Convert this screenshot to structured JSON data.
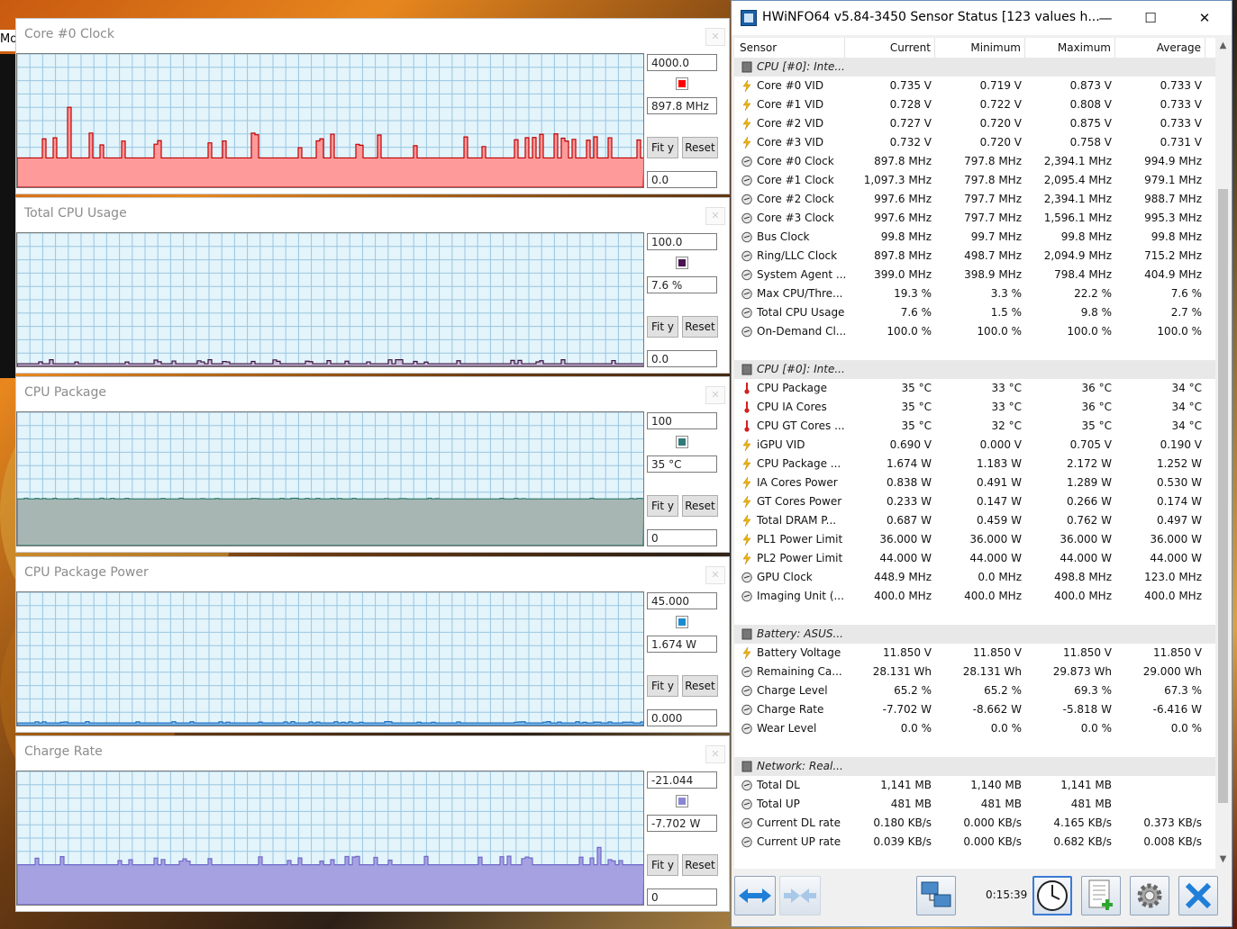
{
  "colors": {
    "accent_hwinfo": "#0066cc",
    "graph_bg": "#e3f4fb",
    "grid": "#9ac6e0"
  },
  "taskbar_fragment": "Mo",
  "graphs": [
    {
      "title": "Core #0 Clock",
      "max": "4000.0",
      "current": "897.8 MHz",
      "min": "0.0",
      "color": "#ff0000",
      "fill": "#ff9a9a",
      "stroke": "#c00000",
      "level": 0.22,
      "spike": 0.6,
      "fity": "Fit y",
      "reset": "Reset"
    },
    {
      "title": "Total CPU Usage",
      "max": "100.0",
      "current": "7.6 %",
      "min": "0.0",
      "color": "#4a1450",
      "fill": "#c8bfd8",
      "stroke": "#3a1040",
      "level": 0.02,
      "spike": 0.08,
      "fity": "Fit y",
      "reset": "Reset"
    },
    {
      "title": "CPU Package",
      "max": "100",
      "current": "35 °C",
      "min": "0",
      "color": "#2f7a78",
      "fill": "#a7b6b2",
      "stroke": "#2a7a70",
      "level": 0.35,
      "spike": 0.36,
      "fity": "Fit y",
      "reset": "Reset"
    },
    {
      "title": "CPU Package Power",
      "max": "45.000",
      "current": "1.674 W",
      "min": "0.000",
      "color": "#1b8bd0",
      "fill": "#7fb8e8",
      "stroke": "#1b6fc0",
      "level": 0.02,
      "spike": 0.04,
      "fity": "Fit y",
      "reset": "Reset"
    },
    {
      "title": "Charge Rate",
      "max": "-21.044",
      "current": "-7.702 W",
      "min": "0",
      "color": "#8a86d6",
      "fill": "#a6a2e2",
      "stroke": "#6e68c8",
      "level": 0.3,
      "spike": 0.43,
      "fity": "Fit y",
      "reset": "Reset"
    }
  ],
  "hwinfo": {
    "title": "HWiNFO64 v5.84-3450 Sensor Status [123 values h...",
    "headers": [
      "Sensor",
      "Current",
      "Minimum",
      "Maximum",
      "Average"
    ],
    "rows": [
      {
        "type": "group",
        "name": "CPU [#0]: Inte..."
      },
      {
        "icon": "bolt-icon",
        "name": "Core #0 VID",
        "v": [
          "0.735 V",
          "0.719 V",
          "0.873 V",
          "0.733 V"
        ]
      },
      {
        "icon": "bolt-icon",
        "name": "Core #1 VID",
        "v": [
          "0.728 V",
          "0.722 V",
          "0.808 V",
          "0.733 V"
        ]
      },
      {
        "icon": "bolt-icon",
        "name": "Core #2 VID",
        "v": [
          "0.727 V",
          "0.720 V",
          "0.875 V",
          "0.733 V"
        ]
      },
      {
        "icon": "bolt-icon",
        "name": "Core #3 VID",
        "v": [
          "0.732 V",
          "0.720 V",
          "0.758 V",
          "0.731 V"
        ]
      },
      {
        "icon": "gauge-icon",
        "name": "Core #0 Clock",
        "v": [
          "897.8 MHz",
          "797.8 MHz",
          "2,394.1 MHz",
          "994.9 MHz"
        ]
      },
      {
        "icon": "gauge-icon",
        "name": "Core #1 Clock",
        "v": [
          "1,097.3 MHz",
          "797.8 MHz",
          "2,095.4 MHz",
          "979.1 MHz"
        ]
      },
      {
        "icon": "gauge-icon",
        "name": "Core #2 Clock",
        "v": [
          "997.6 MHz",
          "797.7 MHz",
          "2,394.1 MHz",
          "988.7 MHz"
        ]
      },
      {
        "icon": "gauge-icon",
        "name": "Core #3 Clock",
        "v": [
          "997.6 MHz",
          "797.7 MHz",
          "1,596.1 MHz",
          "995.3 MHz"
        ]
      },
      {
        "icon": "gauge-icon",
        "name": "Bus Clock",
        "v": [
          "99.8 MHz",
          "99.7 MHz",
          "99.8 MHz",
          "99.8 MHz"
        ]
      },
      {
        "icon": "gauge-icon",
        "name": "Ring/LLC Clock",
        "v": [
          "897.8 MHz",
          "498.7 MHz",
          "2,094.9 MHz",
          "715.2 MHz"
        ]
      },
      {
        "icon": "gauge-icon",
        "name": "System Agent ...",
        "v": [
          "399.0 MHz",
          "398.9 MHz",
          "798.4 MHz",
          "404.9 MHz"
        ]
      },
      {
        "icon": "gauge-icon",
        "name": "Max CPU/Thre...",
        "v": [
          "19.3 %",
          "3.3 %",
          "22.2 %",
          "7.6 %"
        ]
      },
      {
        "icon": "gauge-icon",
        "name": "Total CPU Usage",
        "v": [
          "7.6 %",
          "1.5 %",
          "9.8 %",
          "2.7 %"
        ]
      },
      {
        "icon": "gauge-icon",
        "name": "On-Demand Cl...",
        "v": [
          "100.0 %",
          "100.0 %",
          "100.0 %",
          "100.0 %"
        ]
      },
      {
        "type": "blank"
      },
      {
        "type": "group",
        "name": "CPU [#0]: Inte..."
      },
      {
        "icon": "thermometer-icon",
        "name": "CPU Package",
        "v": [
          "35 °C",
          "33 °C",
          "36 °C",
          "34 °C"
        ]
      },
      {
        "icon": "thermometer-icon",
        "name": "CPU IA Cores",
        "v": [
          "35 °C",
          "33 °C",
          "36 °C",
          "34 °C"
        ]
      },
      {
        "icon": "thermometer-icon",
        "name": "CPU GT Cores ...",
        "v": [
          "35 °C",
          "32 °C",
          "35 °C",
          "34 °C"
        ]
      },
      {
        "icon": "bolt-icon",
        "name": "iGPU VID",
        "v": [
          "0.690 V",
          "0.000 V",
          "0.705 V",
          "0.190 V"
        ]
      },
      {
        "icon": "bolt-icon",
        "name": "CPU Package ...",
        "v": [
          "1.674 W",
          "1.183 W",
          "2.172 W",
          "1.252 W"
        ]
      },
      {
        "icon": "bolt-icon",
        "name": "IA Cores Power",
        "v": [
          "0.838 W",
          "0.491 W",
          "1.289 W",
          "0.530 W"
        ]
      },
      {
        "icon": "bolt-icon",
        "name": "GT Cores Power",
        "v": [
          "0.233 W",
          "0.147 W",
          "0.266 W",
          "0.174 W"
        ]
      },
      {
        "icon": "bolt-icon",
        "name": "Total DRAM P...",
        "v": [
          "0.687 W",
          "0.459 W",
          "0.762 W",
          "0.497 W"
        ]
      },
      {
        "icon": "bolt-icon",
        "name": "PL1 Power Limit",
        "v": [
          "36.000 W",
          "36.000 W",
          "36.000 W",
          "36.000 W"
        ]
      },
      {
        "icon": "bolt-icon",
        "name": "PL2 Power Limit",
        "v": [
          "44.000 W",
          "44.000 W",
          "44.000 W",
          "44.000 W"
        ]
      },
      {
        "icon": "gauge-icon",
        "name": "GPU Clock",
        "v": [
          "448.9 MHz",
          "0.0 MHz",
          "498.8 MHz",
          "123.0 MHz"
        ]
      },
      {
        "icon": "gauge-icon",
        "name": "Imaging Unit (...",
        "v": [
          "400.0 MHz",
          "400.0 MHz",
          "400.0 MHz",
          "400.0 MHz"
        ]
      },
      {
        "type": "blank"
      },
      {
        "type": "group",
        "name": "Battery: ASUS..."
      },
      {
        "icon": "bolt-icon",
        "name": "Battery Voltage",
        "v": [
          "11.850 V",
          "11.850 V",
          "11.850 V",
          "11.850 V"
        ]
      },
      {
        "icon": "gauge-icon",
        "name": "Remaining Ca...",
        "v": [
          "28.131 Wh",
          "28.131 Wh",
          "29.873 Wh",
          "29.000 Wh"
        ]
      },
      {
        "icon": "gauge-icon",
        "name": "Charge Level",
        "v": [
          "65.2 %",
          "65.2 %",
          "69.3 %",
          "67.3 %"
        ]
      },
      {
        "icon": "gauge-icon",
        "name": "Charge Rate",
        "v": [
          "-7.702 W",
          "-8.662 W",
          "-5.818 W",
          "-6.416 W"
        ]
      },
      {
        "icon": "gauge-icon",
        "name": "Wear Level",
        "v": [
          "0.0 %",
          "0.0 %",
          "0.0 %",
          "0.0 %"
        ]
      },
      {
        "type": "blank"
      },
      {
        "type": "group",
        "name": "Network: Real..."
      },
      {
        "icon": "gauge-icon",
        "name": "Total DL",
        "v": [
          "1,141 MB",
          "1,140 MB",
          "1,141 MB",
          ""
        ]
      },
      {
        "icon": "gauge-icon",
        "name": "Total UP",
        "v": [
          "481 MB",
          "481 MB",
          "481 MB",
          ""
        ]
      },
      {
        "icon": "gauge-icon",
        "name": "Current DL rate",
        "v": [
          "0.180 KB/s",
          "0.000 KB/s",
          "4.165 KB/s",
          "0.373 KB/s"
        ]
      },
      {
        "icon": "gauge-icon",
        "name": "Current UP rate",
        "v": [
          "0.039 KB/s",
          "0.000 KB/s",
          "0.682 KB/s",
          "0.008 KB/s"
        ]
      }
    ],
    "timer": "0:15:39"
  }
}
